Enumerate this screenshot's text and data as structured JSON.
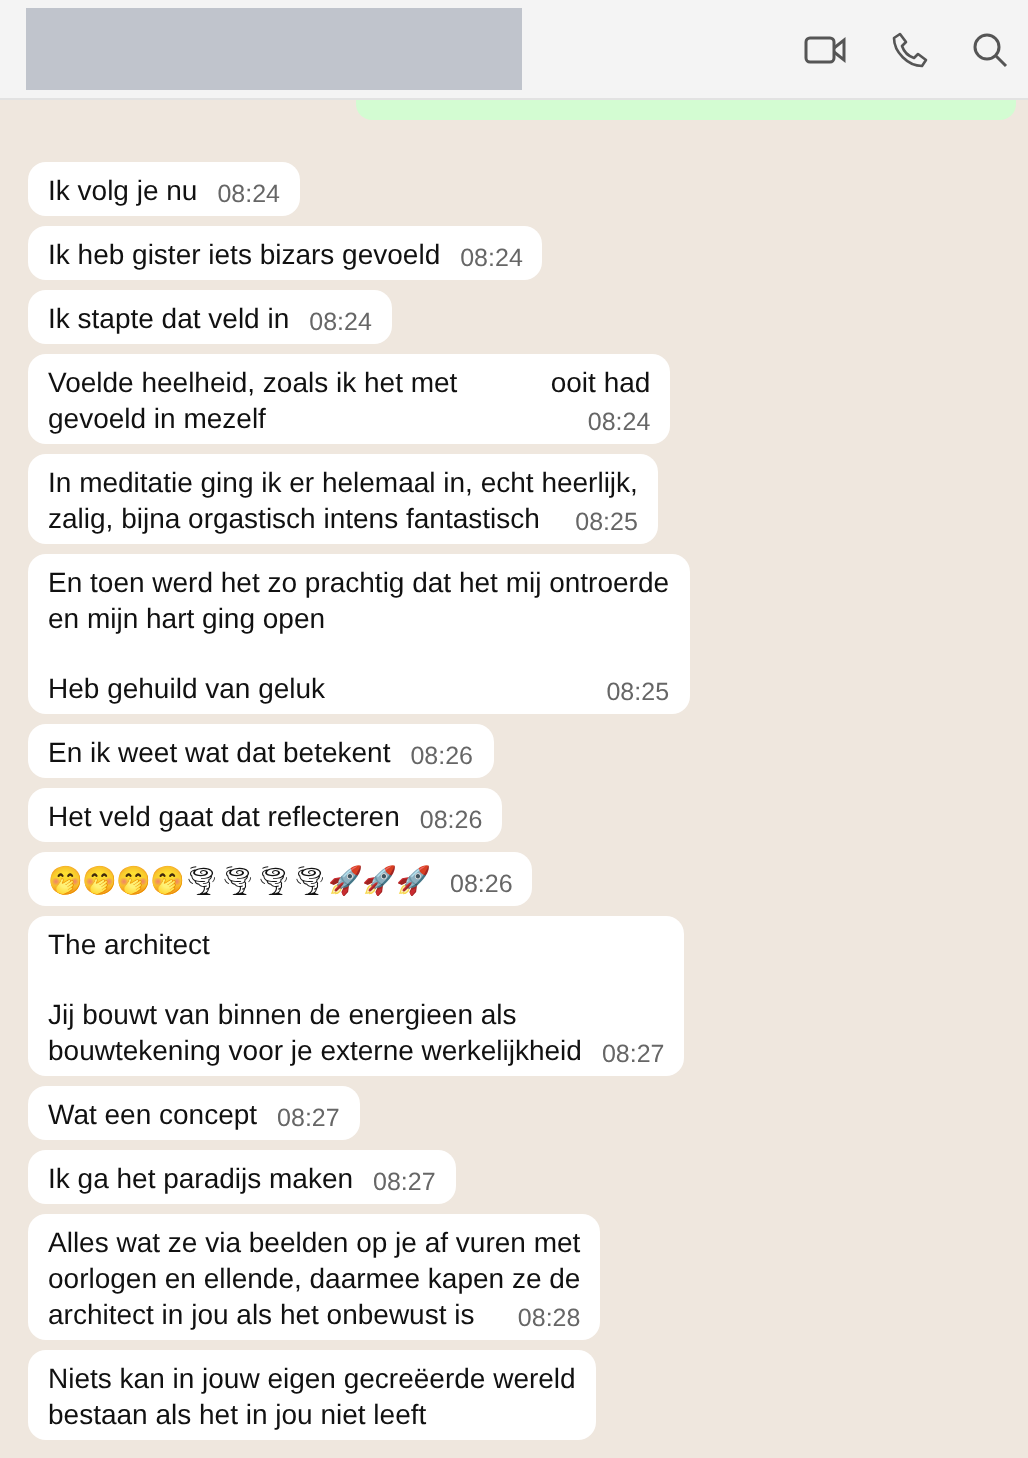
{
  "header": {
    "title_redacted": true
  },
  "messages": [
    {
      "paragraphs": [
        [
          "Ik volg je nu"
        ]
      ],
      "time": "08:24"
    },
    {
      "paragraphs": [
        [
          "Ik heb gister iets bizars gevoeld"
        ]
      ],
      "time": "08:24"
    },
    {
      "paragraphs": [
        [
          "Ik stapte dat veld in"
        ]
      ],
      "time": "08:24"
    },
    {
      "paragraphs": [
        [
          "Voelde heelheid, zoals ik het met            ooit had",
          "gevoeld in mezelf"
        ]
      ],
      "time": "08:24"
    },
    {
      "paragraphs": [
        [
          "In meditatie ging ik er helemaal in, echt heerlijk,",
          "zalig, bijna orgastisch intens fantastisch"
        ]
      ],
      "time": "08:25"
    },
    {
      "paragraphs": [
        [
          "En toen werd het zo prachtig dat het mij ontroerde",
          "en mijn hart ging open"
        ],
        [
          "Heb gehuild van geluk"
        ]
      ],
      "time": "08:25"
    },
    {
      "paragraphs": [
        [
          "En ik weet wat dat betekent"
        ]
      ],
      "time": "08:26"
    },
    {
      "paragraphs": [
        [
          "Het veld gaat dat reflecteren"
        ]
      ],
      "time": "08:26"
    },
    {
      "paragraphs": [
        [
          "🤭🤭🤭🤭🌪🌪🌪🌪🚀🚀🚀"
        ]
      ],
      "time": "08:26"
    },
    {
      "paragraphs": [
        [
          "The architect"
        ],
        [
          "Jij bouwt van binnen de energieen als",
          "bouwtekening voor je externe werkelijkheid"
        ]
      ],
      "time": "08:27"
    },
    {
      "paragraphs": [
        [
          "Wat een concept"
        ]
      ],
      "time": "08:27"
    },
    {
      "paragraphs": [
        [
          "Ik ga het paradijs maken"
        ]
      ],
      "time": "08:27"
    },
    {
      "paragraphs": [
        [
          "Alles wat ze via beelden op je af vuren met",
          "oorlogen en ellende, daarmee kapen ze de",
          "architect in jou als het onbewust is"
        ]
      ],
      "time": "08:28"
    },
    {
      "paragraphs": [
        [
          "Niets kan in jouw eigen gecreëerde wereld",
          "bestaan als het in jou niet leeft"
        ]
      ]
    }
  ]
}
